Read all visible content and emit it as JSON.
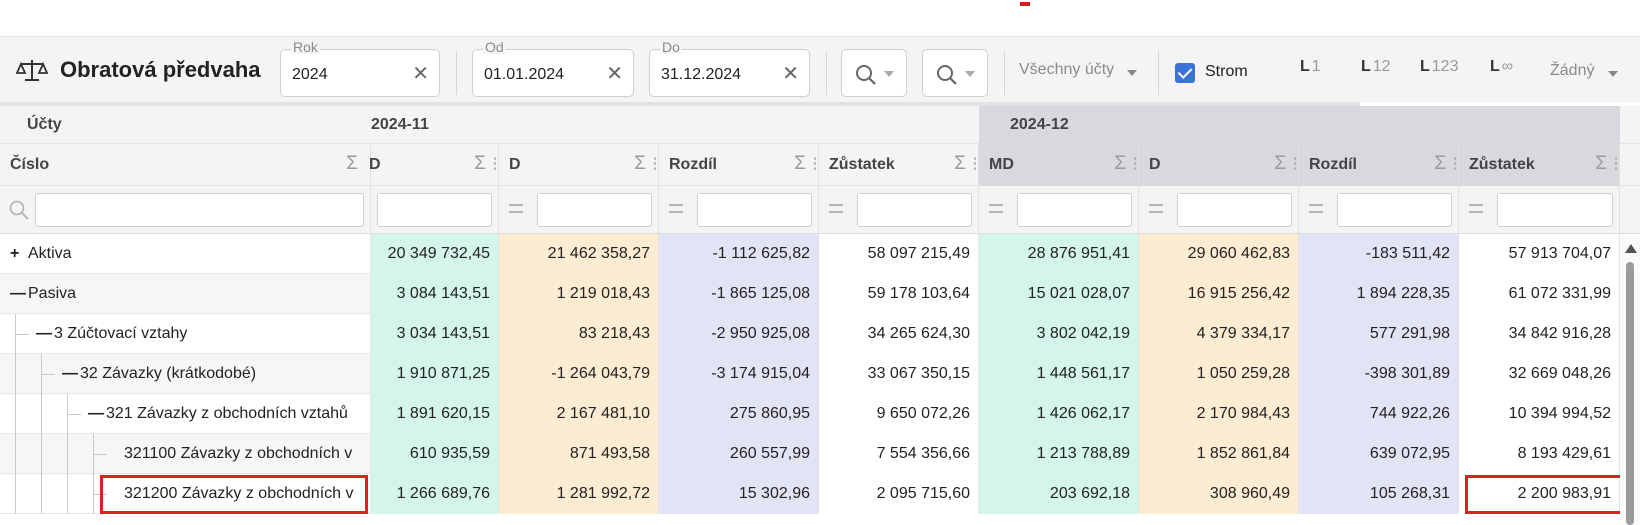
{
  "toolbar": {
    "title": "Obratová předvaha",
    "rok": {
      "label": "Rok",
      "value": "2024"
    },
    "od": {
      "label": "Od",
      "value": "01.01.2024"
    },
    "do": {
      "label": "Do",
      "value": "31.12.2024"
    },
    "clear_glyph": "✕",
    "accounts_filter": "Všechny účty",
    "tree_checkbox": {
      "label": "Strom",
      "checked": true
    },
    "levels": [
      {
        "prefix": "L",
        "text": "1"
      },
      {
        "prefix": "L",
        "text": "12"
      },
      {
        "prefix": "L",
        "text": "123"
      },
      {
        "prefix": "L",
        "text": "∞"
      }
    ],
    "none_dropdown": "Žádný"
  },
  "grid": {
    "groups": {
      "accounts": "Účty",
      "nov": "2024-11",
      "dec": "2024-12"
    },
    "columns": {
      "cislo": "Číslo",
      "nov_md": "D",
      "nov_d": "D",
      "nov_rozdil": "Rozdíl",
      "nov_zustatek": "Zůstatek",
      "dec_md": "MD",
      "dec_d": "D",
      "dec_rozdil": "Rozdíl",
      "dec_zustatek": "Zůstatek"
    },
    "sum_glyph": "Σ",
    "rows": [
      {
        "toggle": "+",
        "label": "Aktiva",
        "v": [
          "20 349 732,45",
          "21 462 358,27",
          "-1 112 625,82",
          "58 097 215,49",
          "28 876 951,41",
          "29 060 462,83",
          "-183 511,42",
          "57 913 704,07"
        ]
      },
      {
        "toggle": "—",
        "label": "Pasiva",
        "v": [
          "3 084 143,51",
          "1 219 018,43",
          "-1 865 125,08",
          "59 178 103,64",
          "15 021 028,07",
          "16 915 256,42",
          "1 894 228,35",
          "61 072 331,99"
        ]
      },
      {
        "toggle": "—",
        "label": "3 Zúčtovací vztahy",
        "v": [
          "3 034 143,51",
          "83 218,43",
          "-2 950 925,08",
          "34 265 624,30",
          "3 802 042,19",
          "4 379 334,17",
          "577 291,98",
          "34 842 916,28"
        ]
      },
      {
        "toggle": "—",
        "label": "32 Závazky (krátkodobé)",
        "v": [
          "1 910 871,25",
          "-1 264 043,79",
          "-3 174 915,04",
          "33 067 350,15",
          "1 448 561,17",
          "1 050 259,28",
          "-398 301,89",
          "32 669 048,26"
        ]
      },
      {
        "toggle": "—",
        "label": "321 Závazky z obchodních vztahů",
        "v": [
          "1 891 620,15",
          "2 167 481,10",
          "275 860,95",
          "9 650 072,26",
          "1 426 062,17",
          "2 170 984,43",
          "744 922,26",
          "10 394 994,52"
        ]
      },
      {
        "toggle": "",
        "label": "321100 Závazky z obchodních v",
        "v": [
          "610 935,59",
          "871 493,58",
          "260 557,99",
          "7 554 356,66",
          "1 213 788,89",
          "1 852 861,84",
          "639 072,95",
          "8 193 429,61"
        ]
      },
      {
        "toggle": "",
        "label": "321200 Závazky z obchodních v",
        "v": [
          "1 266 689,76",
          "1 281 992,72",
          "15 302,96",
          "2 095 715,60",
          "203 692,18",
          "308 960,49",
          "105 268,31",
          "2 200 983,91"
        ]
      }
    ]
  },
  "colors": {
    "md": "#d3f5ea",
    "d": "#fdebd2",
    "rozdil": "#e3e3f6",
    "zustatek": "#ffffff",
    "highlight": "#e02020",
    "checkbox": "#3b73d6"
  }
}
